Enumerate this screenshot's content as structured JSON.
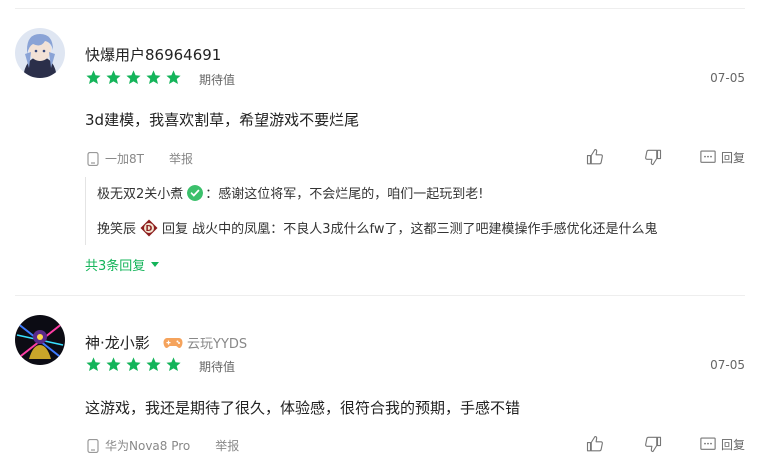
{
  "reviews": [
    {
      "username": "快爆用户86964691",
      "stars": 5,
      "rating_label": "期待值",
      "date": "07-05",
      "content": "3d建模，我喜欢割草，希望游戏不要烂尾",
      "device": "一加8T",
      "report_label": "举报",
      "reply_label": "回复",
      "replies": [
        {
          "author": "极无双2关小煮",
          "separator": "：",
          "text": "感谢这位将军，不会烂尾的，咱们一起玩到老!"
        },
        {
          "author": "挽笑辰",
          "reply_word": "回复",
          "target": "战火中的凤凰",
          "separator": "：",
          "text": "不良人3成什么fw了，这都三测了吧建模操作手感优化还是什么鬼"
        }
      ],
      "more_replies": "共3条回复"
    },
    {
      "username": "神·龙小影",
      "badge": "云玩YYDS",
      "stars": 5,
      "rating_label": "期待值",
      "date": "07-05",
      "content": "这游戏，我还是期待了很久，体验感，很符合我的预期，手感不错",
      "device": "华为Nova8 Pro",
      "report_label": "举报",
      "reply_label": "回复"
    }
  ],
  "colors": {
    "star": "#14b45a",
    "accent": "#14b45a",
    "verified": "#3bc06b",
    "divider": "#eeeeee"
  },
  "icons": [
    "phone-icon",
    "thumbs-up-icon",
    "thumbs-down-icon",
    "comment-icon",
    "verified-icon",
    "d-badge-icon",
    "gamepad-icon",
    "caret-down-icon"
  ]
}
